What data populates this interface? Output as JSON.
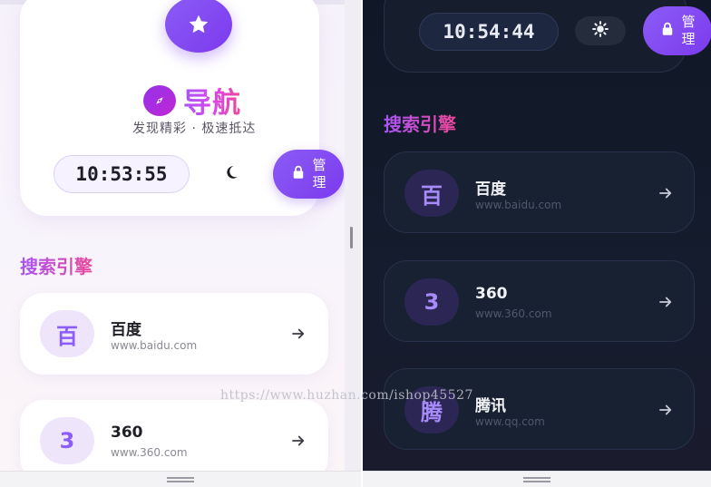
{
  "light": {
    "header": {
      "title": "导航",
      "subtitle": "发现精彩 · 极速抵达",
      "clock": "10:53:55",
      "admin_label": "管理"
    },
    "section_title": "搜索引擎",
    "engines": [
      {
        "icon_text": "百",
        "name": "百度",
        "url": "www.baidu.com"
      },
      {
        "icon_text": "3",
        "name": "360",
        "url": "www.360.com"
      }
    ]
  },
  "dark": {
    "header": {
      "clock": "10:54:44",
      "admin_label": "管理"
    },
    "section_title": "搜索引擎",
    "engines": [
      {
        "icon_text": "百",
        "name": "百度",
        "url": "www.baidu.com"
      },
      {
        "icon_text": "3",
        "name": "360",
        "url": "www.360.com"
      },
      {
        "icon_text": "腾",
        "name": "腾讯",
        "url": "www.qq.com"
      }
    ]
  },
  "watermark": "https://www.huzhan.com/ishop45527",
  "icons": {
    "star": "star-icon",
    "compass": "compass-icon",
    "theme_light": "moon-icon",
    "theme_dark": "sun-icon",
    "lock": "lock-icon",
    "arrow": "arrow-right-icon"
  },
  "colors": {
    "accent": "#8b5cf6",
    "accent_dark": "#7c3aed",
    "gradient_pink": "#ec4899",
    "dark_bg": "#121a2a"
  }
}
